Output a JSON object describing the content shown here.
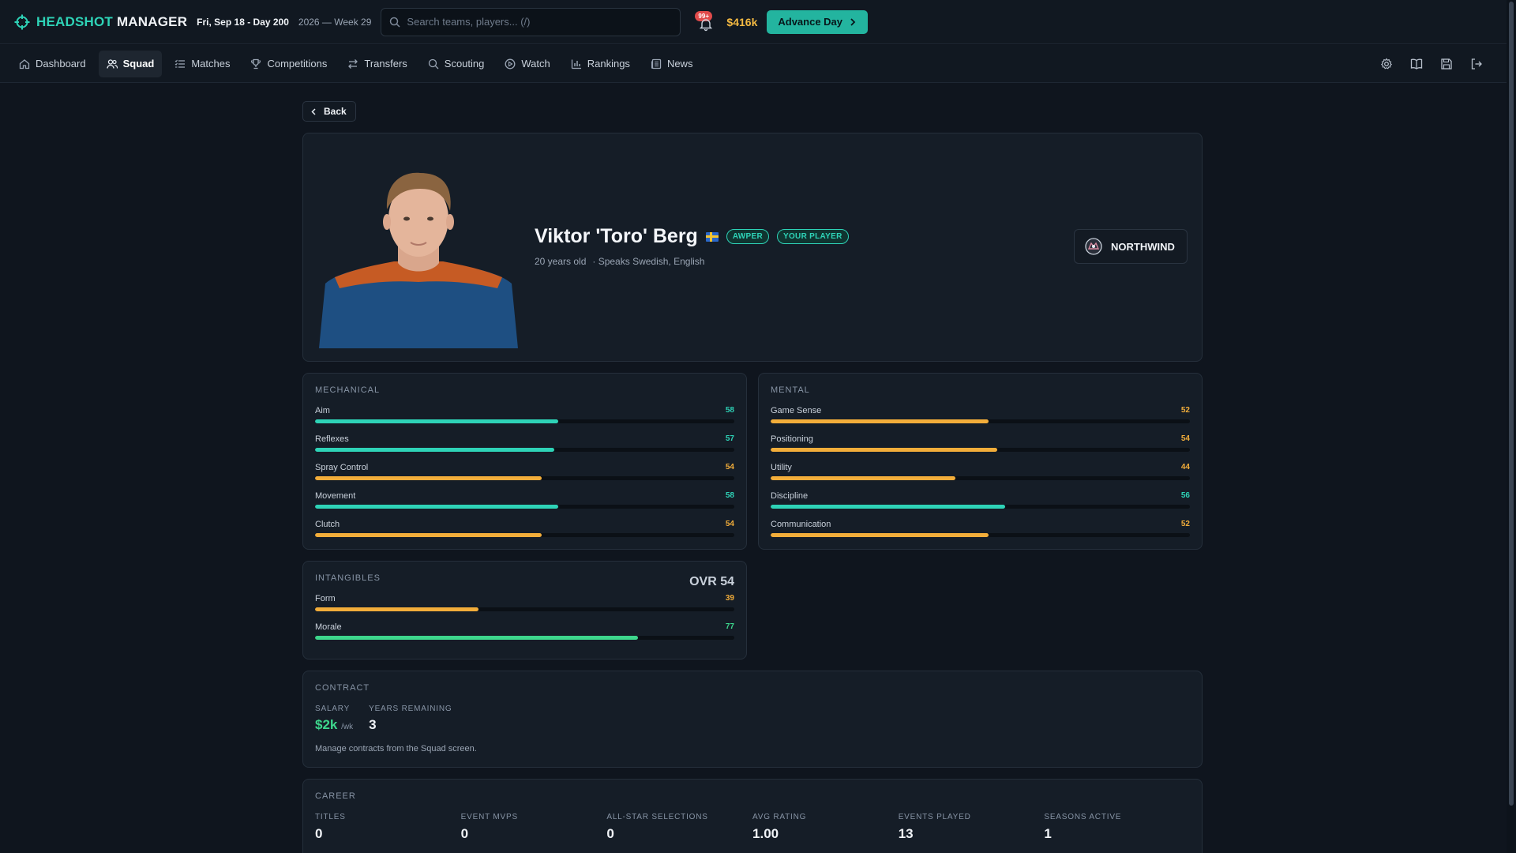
{
  "topbar": {
    "logo_accent": "HEADSHOT",
    "logo_rest": "MANAGER",
    "date": "Fri, Sep 18 - Day 200",
    "week": "2026 — Week 29",
    "search_placeholder": "Search teams, players... (/)",
    "notif_badge": "99+",
    "money": "$416k",
    "advance_label": "Advance Day"
  },
  "nav": {
    "items": [
      {
        "label": "Dashboard",
        "icon": "home-icon"
      },
      {
        "label": "Squad",
        "icon": "users-icon"
      },
      {
        "label": "Matches",
        "icon": "list-icon"
      },
      {
        "label": "Competitions",
        "icon": "trophy-icon"
      },
      {
        "label": "Transfers",
        "icon": "arrows-icon"
      },
      {
        "label": "Scouting",
        "icon": "search-icon"
      },
      {
        "label": "Watch",
        "icon": "play-icon"
      },
      {
        "label": "Rankings",
        "icon": "bar-chart-icon"
      },
      {
        "label": "News",
        "icon": "newspaper-icon"
      }
    ],
    "active": "Squad",
    "right_icons": [
      "gear-icon",
      "book-icon",
      "save-icon",
      "logout-icon"
    ]
  },
  "back_label": "Back",
  "player": {
    "name": "Viktor 'Toro' Berg",
    "role_tag": "AWPER",
    "ownership_tag": "YOUR PLAYER",
    "age": "20 years old",
    "languages": "· Speaks Swedish, English",
    "team": "NORTHWIND"
  },
  "mechanical": {
    "title": "MECHANICAL",
    "attrs": [
      {
        "label": "Aim",
        "value": "58",
        "pct": 58,
        "color": "teal"
      },
      {
        "label": "Reflexes",
        "value": "57",
        "pct": 57,
        "color": "teal"
      },
      {
        "label": "Spray Control",
        "value": "54",
        "pct": 54,
        "color": "amber"
      },
      {
        "label": "Movement",
        "value": "58",
        "pct": 58,
        "color": "teal"
      },
      {
        "label": "Clutch",
        "value": "54",
        "pct": 54,
        "color": "amber"
      }
    ]
  },
  "mental": {
    "title": "MENTAL",
    "attrs": [
      {
        "label": "Game Sense",
        "value": "52",
        "pct": 52,
        "color": "amber"
      },
      {
        "label": "Positioning",
        "value": "54",
        "pct": 54,
        "color": "amber"
      },
      {
        "label": "Utility",
        "value": "44",
        "pct": 44,
        "color": "amber"
      },
      {
        "label": "Discipline",
        "value": "56",
        "pct": 56,
        "color": "teal"
      },
      {
        "label": "Communication",
        "value": "52",
        "pct": 52,
        "color": "amber"
      }
    ]
  },
  "intangibles": {
    "title": "INTANGIBLES",
    "ovr": "OVR 54",
    "attrs": [
      {
        "label": "Form",
        "value": "39",
        "pct": 39,
        "color": "amber"
      },
      {
        "label": "Morale",
        "value": "77",
        "pct": 77,
        "color": "green"
      }
    ]
  },
  "contract": {
    "title": "CONTRACT",
    "salary_label": "SALARY",
    "salary_value": "$2k",
    "salary_unit": "/wk",
    "years_label": "YEARS REMAINING",
    "years_value": "3",
    "note": "Manage contracts from the Squad screen."
  },
  "career": {
    "title": "CAREER",
    "stats": [
      {
        "label": "TITLES",
        "value": "0"
      },
      {
        "label": "EVENT MVPS",
        "value": "0"
      },
      {
        "label": "ALL-STAR SELECTIONS",
        "value": "0"
      },
      {
        "label": "AVG RATING",
        "value": "1.00"
      },
      {
        "label": "EVENTS PLAYED",
        "value": "13"
      },
      {
        "label": "SEASONS ACTIVE",
        "value": "1"
      }
    ]
  },
  "colors": {
    "accent": "#2ed3b7",
    "amber": "#f2ad3a",
    "green": "#3dd68c",
    "money": "#f4b942",
    "badge": "#e14b4b"
  }
}
